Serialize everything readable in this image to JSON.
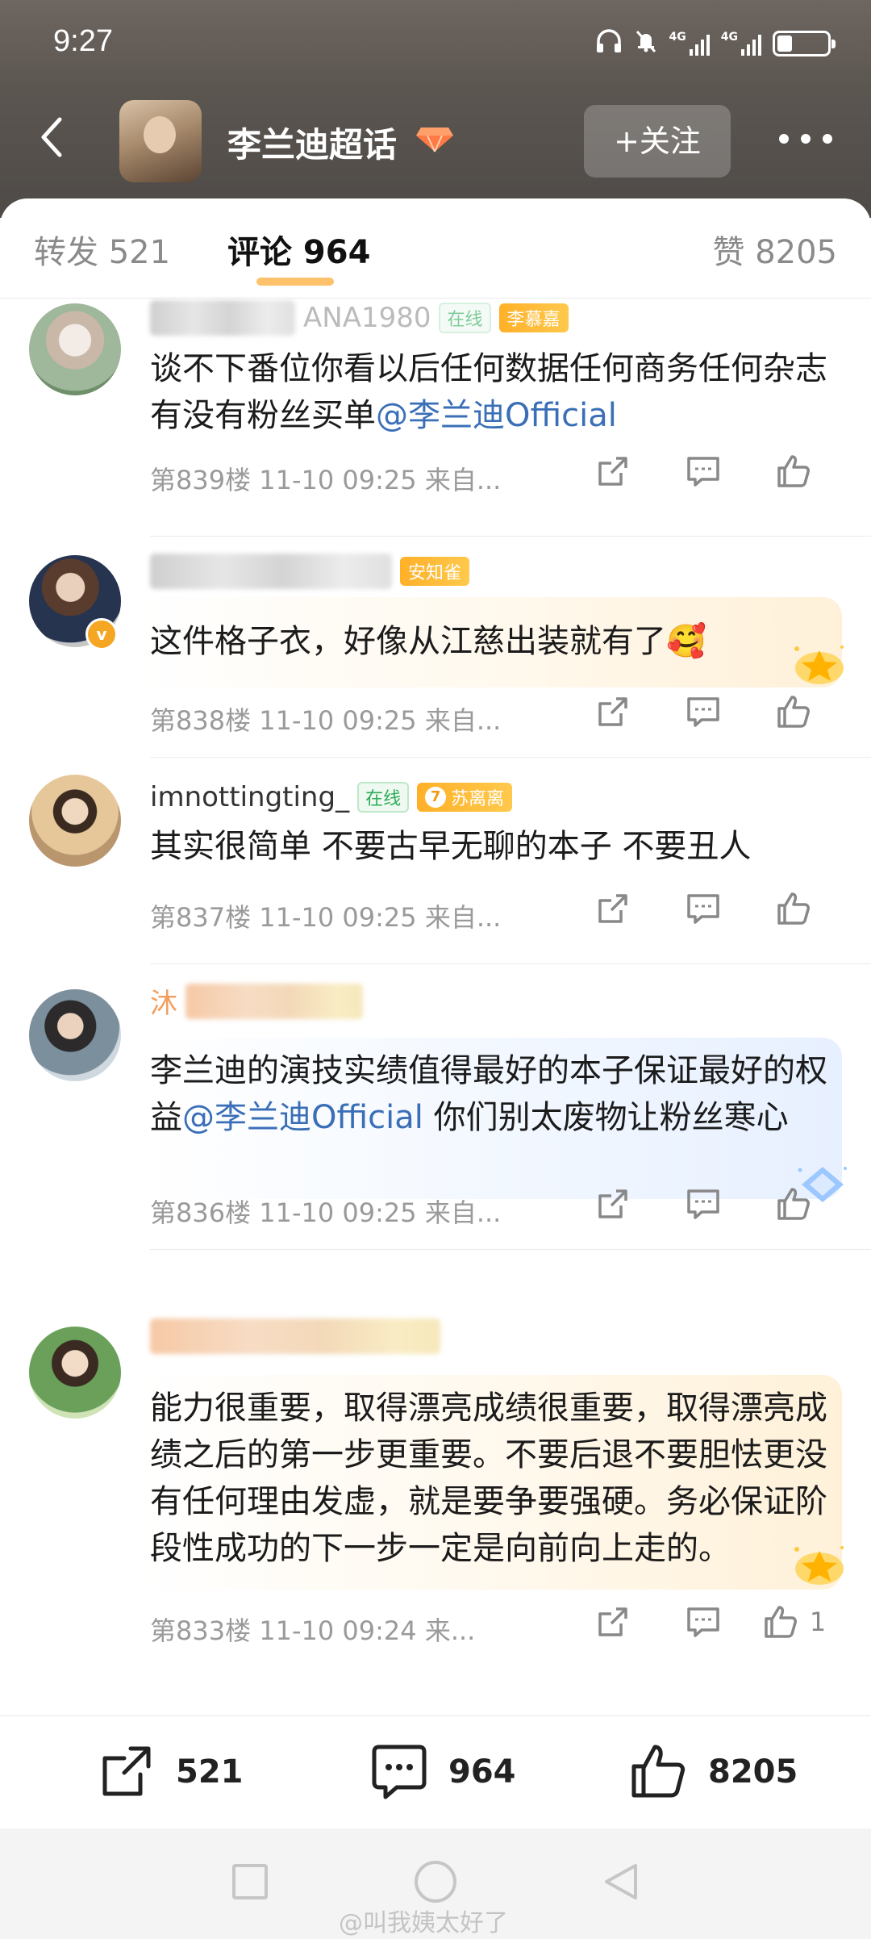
{
  "status_bar": {
    "time": "9:27",
    "network1": "4G",
    "network2": "4G"
  },
  "nav": {
    "title": "李兰迪超话",
    "follow_label": "+关注"
  },
  "tabs": {
    "repost": "转发 521",
    "comment": "评论 964",
    "like": "赞 8205"
  },
  "comments": [
    {
      "name_visible": "ANA1980",
      "badge_online": "在线",
      "badge_fan": "李慕嘉",
      "text": "谈不下番位你看以后任何数据任何商务任何杂志有没有粉丝买单",
      "mention": "@李兰迪Official",
      "floor": "第839楼",
      "datetime": "11-10 09:25",
      "source": "来自..."
    },
    {
      "badge_fan": "安知雀",
      "verified": true,
      "text": "这件格子衣，好像从江慈出装就有了🥰",
      "floor": "第838楼",
      "datetime": "11-10 09:25",
      "source": "来自..."
    },
    {
      "name": "imnottingting_",
      "badge_online": "在线",
      "fan_level": "7",
      "badge_fan": "苏离离",
      "text": "其实很简单 不要古早无聊的本子 不要丑人",
      "floor": "第837楼",
      "datetime": "11-10 09:25",
      "source": "来自..."
    },
    {
      "name_visible": "沐",
      "text_before": "李兰迪的演技实绩值得最好的本子保证最好的权益",
      "mention": "@李兰迪Official",
      "text_after": " 你们别太废物让粉丝寒心",
      "floor": "第836楼",
      "datetime": "11-10 09:25",
      "source": "来自..."
    },
    {
      "text": "能力很重要，取得漂亮成绩很重要，取得漂亮成绩之后的第一步更重要。不要后退不要胆怯更没有任何理由发虚，就是要争要强硬。务必保证阶段性成功的下一步一定是向前向上走的。",
      "floor": "第833楼",
      "datetime": "11-10 09:24",
      "source": "来...",
      "like_count": "1"
    }
  ],
  "bottom_bar": {
    "repost_count": "521",
    "comment_count": "964",
    "like_count": "8205"
  },
  "watermark": "@叫我姨太好了",
  "colors": {
    "mention": "#3a6fb7",
    "fan_badge": "#ffb028",
    "online_badge": "#2eaa58"
  }
}
